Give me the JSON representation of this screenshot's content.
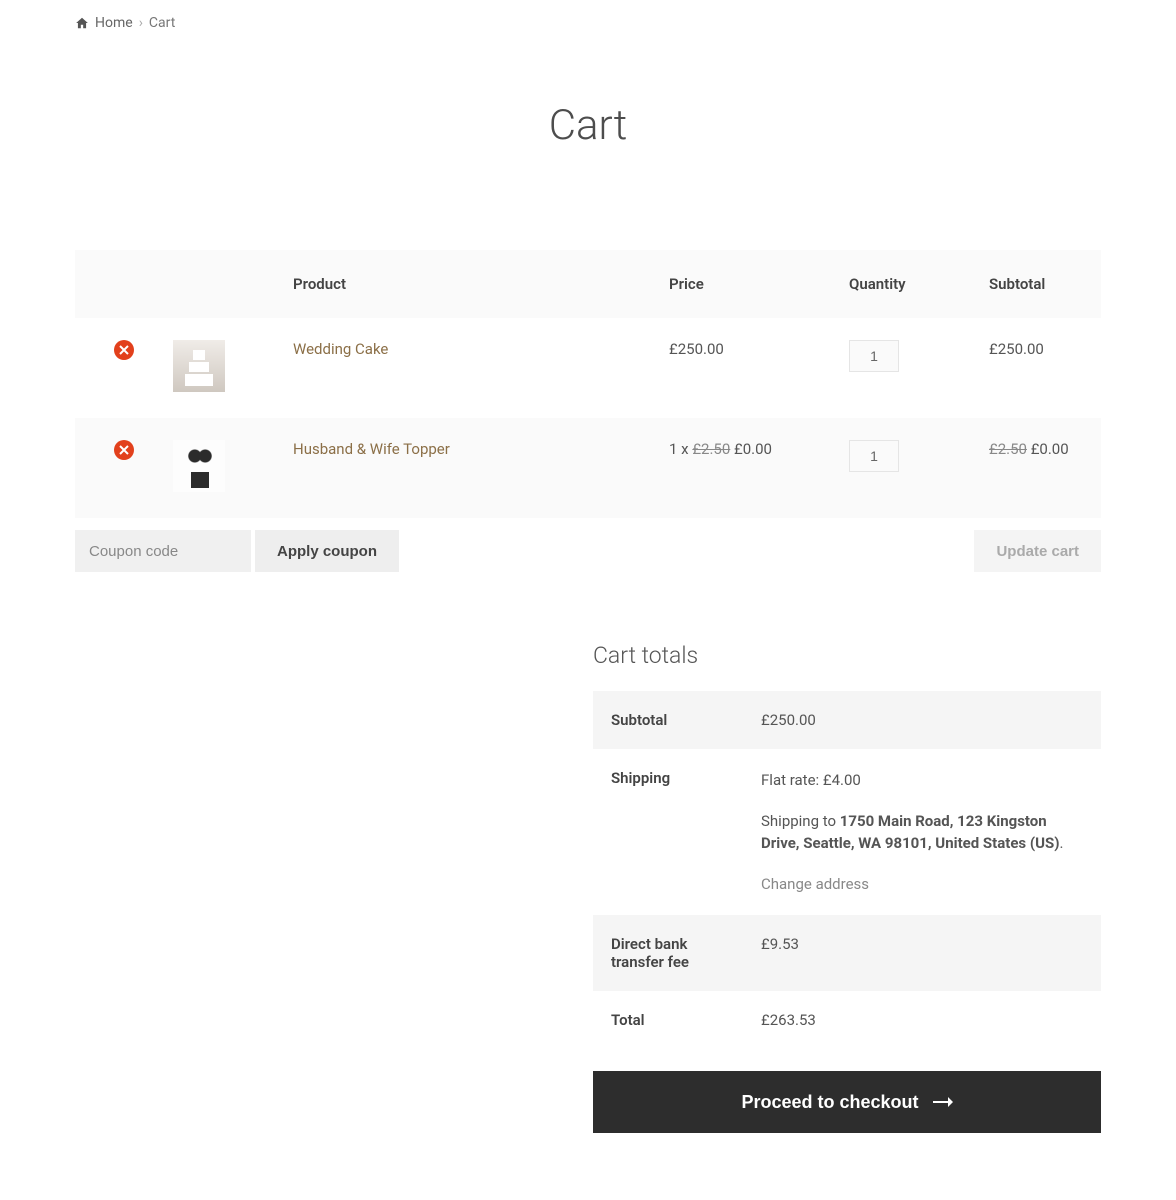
{
  "breadcrumb": {
    "home": "Home",
    "current": "Cart",
    "separator": "›"
  },
  "page_title": "Cart",
  "table": {
    "headers": {
      "product": "Product",
      "price": "Price",
      "quantity": "Quantity",
      "subtotal": "Subtotal"
    },
    "rows": [
      {
        "name": "Wedding Cake",
        "price_prefix": "",
        "price_struck": "",
        "price": "£250.00",
        "qty": "1",
        "subtotal_struck": "",
        "subtotal": "£250.00",
        "thumb": "cake"
      },
      {
        "name": "Husband & Wife Topper",
        "price_prefix": "1 x ",
        "price_struck": "£2.50",
        "price": " £0.00",
        "qty": "1",
        "subtotal_struck": "£2.50",
        "subtotal": " £0.00",
        "thumb": "topper"
      }
    ]
  },
  "coupon": {
    "placeholder": "Coupon code",
    "apply_label": "Apply coupon"
  },
  "update_label": "Update cart",
  "totals": {
    "title": "Cart totals",
    "subtotal_label": "Subtotal",
    "subtotal_value": "£250.00",
    "shipping_label": "Shipping",
    "shipping_rate": "Flat rate: £4.00",
    "shipping_to_prefix": "Shipping to ",
    "shipping_address": "1750 Main Road, 123 Kingston Drive, Seattle, WA 98101, United States (US)",
    "shipping_period": ".",
    "change_address": "Change address",
    "fee_label": "Direct bank transfer fee",
    "fee_value": "£9.53",
    "total_label": "Total",
    "total_value": "£263.53"
  },
  "checkout_label": "Proceed to checkout"
}
